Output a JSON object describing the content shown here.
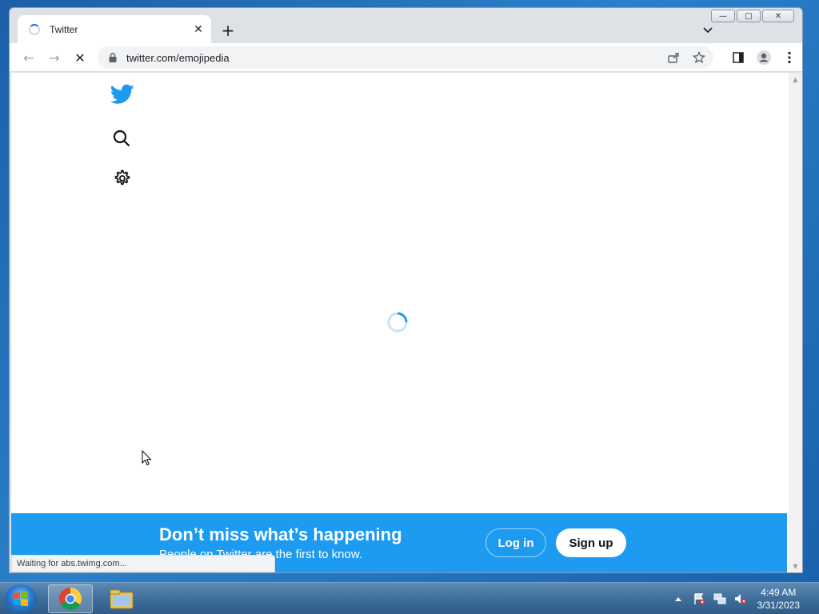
{
  "browser": {
    "tab_title": "Twitter",
    "url": "twitter.com/emojipedia",
    "status_text": "Waiting for abs.twimg.com..."
  },
  "page": {
    "banner_title": "Don’t miss what’s happening",
    "banner_subtitle": "People on Twitter are the first to know.",
    "login_label": "Log in",
    "signup_label": "Sign up"
  },
  "taskbar": {
    "time": "4:49 AM",
    "date": "3/31/2023"
  },
  "colors": {
    "twitter_blue": "#1d9bf0",
    "chrome_bg": "#dee1e6"
  }
}
